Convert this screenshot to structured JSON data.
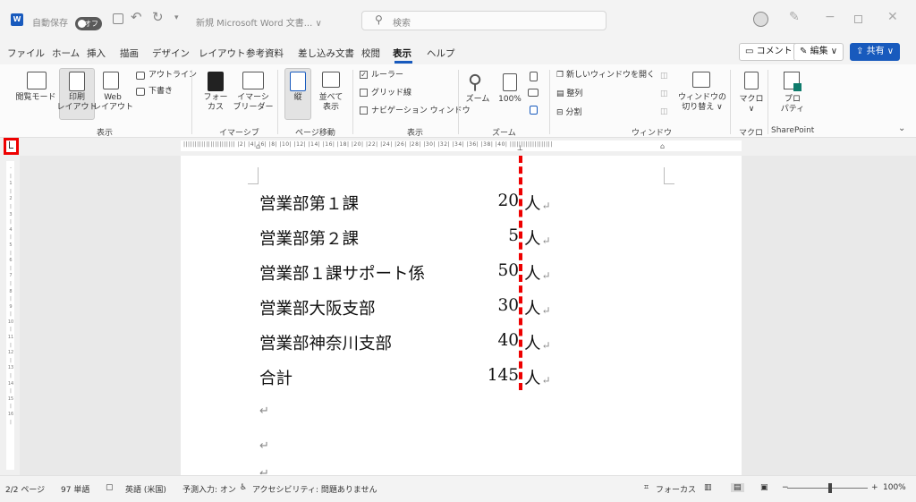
{
  "titlebar": {
    "autosave_label": "自動保存",
    "autosave_state": "オフ",
    "doc_title": "新規 Microsoft Word 文書... ∨",
    "search_placeholder": "検索"
  },
  "menu": {
    "tabs": [
      "ファイル",
      "ホーム",
      "挿入",
      "描画",
      "デザイン",
      "レイアウト",
      "参考資料",
      "差し込み文書",
      "校閲",
      "表示",
      "ヘルプ"
    ],
    "active_tab": "表示",
    "comment_btn": "コメント",
    "edit_btn": "編集 ∨",
    "share_btn": "共有 ∨"
  },
  "ribbon": {
    "read_mode": "閲覧モード",
    "print_layout": "印刷\nレイアウト",
    "web_layout": "Web\nレイアウト",
    "outline": "アウトライン",
    "draft": "下書き",
    "group_view": "表示",
    "focus": "フォー\nカス",
    "immersive_reader": "イマーシ\nブリーダー",
    "group_immersive": "イマーシブ",
    "vertical": "縦",
    "side_by_side": "並べて\n表示",
    "group_page_move": "ページ移動",
    "ruler": "ルーラー",
    "gridlines": "グリッド線",
    "nav_pane": "ナビゲーション ウィンドウ",
    "group_show": "表示",
    "zoom": "ズーム",
    "zoom_100": "100%",
    "group_zoom": "ズーム",
    "new_window": "新しいウィンドウを開く",
    "arrange": "整列",
    "split": "分割",
    "switch_windows": "ウィンドウの\n切り替え ∨",
    "group_window": "ウィンドウ",
    "macros": "マクロ\n∨",
    "group_macro": "マクロ",
    "properties": "プロ\nパティ",
    "group_sharepoint": "SharePoint"
  },
  "ruler_ticks": "|||||||||||||||||||||||  |2| |4| |6| |8| |10| |12| |14| |16| |18| |20| |22| |24| |26| |28| |30| |32| |34| |36| |38| |40| |||||||||||||||||||",
  "document": {
    "rows": [
      {
        "name": "営業部第１課",
        "count": "20",
        "unit": "人"
      },
      {
        "name": "営業部第２課",
        "count": "5",
        "unit": "人"
      },
      {
        "name": "営業部１課サポート係",
        "count": "50",
        "unit": "人"
      },
      {
        "name": "営業部大阪支部",
        "count": "30",
        "unit": "人"
      },
      {
        "name": "営業部神奈川支部",
        "count": "40",
        "unit": "人"
      },
      {
        "name": "合計",
        "count": "145",
        "unit": "人"
      }
    ],
    "return_mark": "↵"
  },
  "status": {
    "page": "2/2 ページ",
    "words": "97 単語",
    "language": "英語 (米国)",
    "predictive": "予測入力: オン",
    "accessibility": "アクセシビリティ: 問題ありません",
    "focus": "フォーカス",
    "zoom_minus": "−",
    "zoom_plus": "+",
    "zoom_level": "100%"
  },
  "colors": {
    "accent": "#185abd",
    "highlight_red": "#e00000"
  }
}
